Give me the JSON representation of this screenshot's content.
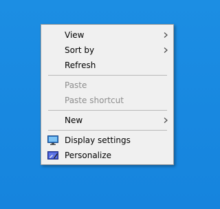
{
  "context_menu": {
    "items": [
      {
        "label": "View",
        "submenu": true,
        "enabled": true
      },
      {
        "label": "Sort by",
        "submenu": true,
        "enabled": true
      },
      {
        "label": "Refresh",
        "submenu": false,
        "enabled": true
      },
      {
        "label": "Paste",
        "submenu": false,
        "enabled": false
      },
      {
        "label": "Paste shortcut",
        "submenu": false,
        "enabled": false
      },
      {
        "label": "New",
        "submenu": true,
        "enabled": true
      },
      {
        "label": "Display settings",
        "icon": "display-icon",
        "enabled": true
      },
      {
        "label": "Personalize",
        "icon": "personalize-icon",
        "enabled": true
      }
    ]
  },
  "colors": {
    "desktop_background": "#1a8ae2",
    "menu_background": "#f0f0f0",
    "disabled_text": "#8d8d8d"
  }
}
